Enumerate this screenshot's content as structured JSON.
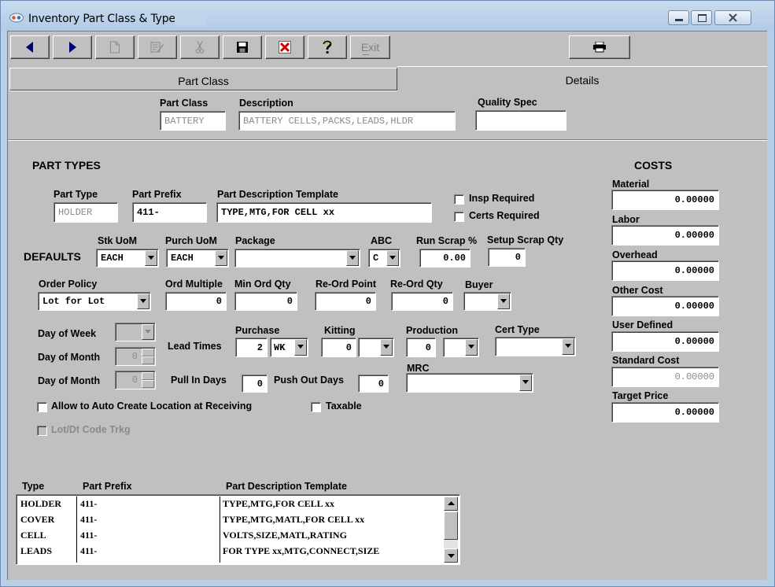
{
  "window": {
    "title": "Inventory Part Class & Type"
  },
  "toolbar": {
    "exit_label": "Exit"
  },
  "tabs": [
    {
      "label": "Part Class"
    },
    {
      "label": "Details"
    }
  ],
  "header": {
    "part_class_label": "Part Class",
    "part_class_value": "BATTERY",
    "description_label": "Description",
    "description_value": "BATTERY CELLS,PACKS,LEADS,HLDR",
    "quality_spec_label": "Quality Spec",
    "quality_spec_value": ""
  },
  "part_types": {
    "title": "PART TYPES",
    "part_type_label": "Part Type",
    "part_type_value": "HOLDER",
    "part_prefix_label": "Part Prefix",
    "part_prefix_value": "411-",
    "template_label": "Part Description Template",
    "template_value": "TYPE,MTG,FOR CELL xx",
    "insp_required_label": "Insp Required",
    "certs_required_label": "Certs Required"
  },
  "defaults": {
    "label": "DEFAULTS",
    "stk_uom_label": "Stk UoM",
    "stk_uom_value": "EACH",
    "purch_uom_label": "Purch UoM",
    "purch_uom_value": "EACH",
    "package_label": "Package",
    "package_value": "",
    "abc_label": "ABC",
    "abc_value": "C",
    "run_scrap_label": "Run Scrap %",
    "run_scrap_value": "0.00",
    "setup_scrap_label": "Setup Scrap Qty",
    "setup_scrap_value": "0",
    "order_policy_label": "Order Policy",
    "order_policy_value": "Lot for Lot",
    "ord_multiple_label": "Ord Multiple",
    "ord_multiple_value": "0",
    "min_ord_qty_label": "Min Ord Qty",
    "min_ord_qty_value": "0",
    "reord_point_label": "Re-Ord Point",
    "reord_point_value": "0",
    "reord_qty_label": "Re-Ord Qty",
    "reord_qty_value": "0",
    "buyer_label": "Buyer",
    "buyer_value": "",
    "day_of_week_label": "Day of Week",
    "day_of_month_label": "Day of Month",
    "day_of_month_value": "0",
    "day_of_month2_label": "Day of Month",
    "day_of_month2_value": "0",
    "lead_times_label": "Lead Times",
    "purchase_label": "Purchase",
    "purchase_value": "2",
    "purchase_unit": "WK",
    "kitting_label": "Kitting",
    "kitting_value": "0",
    "kitting_unit": "",
    "production_label": "Production",
    "production_value": "0",
    "production_unit": "",
    "cert_type_label": "Cert Type",
    "cert_type_value": "",
    "pull_in_label": "Pull In Days",
    "pull_in_value": "0",
    "push_out_label": "Push Out Days",
    "push_out_value": "0",
    "mrc_label": "MRC",
    "mrc_value": "",
    "auto_create_label": "Allow to Auto Create Location at Receiving",
    "taxable_label": "Taxable",
    "lot_code_label": "Lot/Dt Code Trkg"
  },
  "costs": {
    "title": "COSTS",
    "items": [
      {
        "label": "Material",
        "value": "0.00000"
      },
      {
        "label": "Labor",
        "value": "0.00000"
      },
      {
        "label": "Overhead",
        "value": "0.00000"
      },
      {
        "label": "Other Cost",
        "value": "0.00000"
      },
      {
        "label": "User Defined",
        "value": "0.00000"
      },
      {
        "label": "Standard Cost",
        "value": "0.00000"
      },
      {
        "label": "Target Price",
        "value": "0.00000"
      }
    ]
  },
  "type_grid": {
    "columns": [
      "Type",
      "Part Prefix",
      "Part Description Template"
    ],
    "rows": [
      {
        "type": "HOLDER",
        "prefix": "411-",
        "template": "TYPE,MTG,FOR CELL xx"
      },
      {
        "type": "COVER",
        "prefix": "411-",
        "template": "TYPE,MTG,MATL,FOR CELL xx"
      },
      {
        "type": "CELL",
        "prefix": "411-",
        "template": "VOLTS,SIZE,MATL,RATING"
      },
      {
        "type": "LEADS",
        "prefix": "411-",
        "template": "FOR TYPE xx,MTG,CONNECT,SIZE"
      }
    ]
  }
}
